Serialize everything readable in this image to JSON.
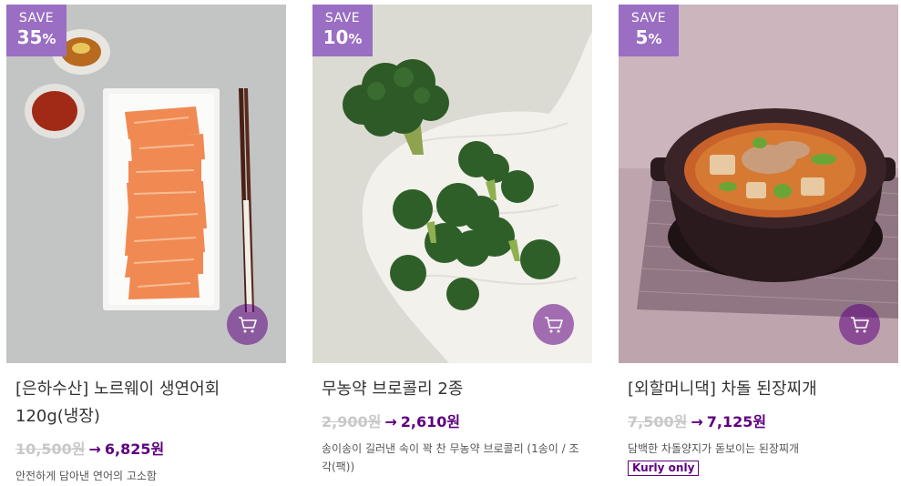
{
  "products": [
    {
      "save_label": "SAVE",
      "save_pct": "35",
      "pct_sign": "%",
      "title": "[은하수산] 노르웨이 생연어회 120g(냉장)",
      "original_price": "10,500원",
      "arrow": "→",
      "sale_price": "6,825원",
      "description": "안전하게 담아낸 연어의 고소함",
      "badge": ""
    },
    {
      "save_label": "SAVE",
      "save_pct": "10",
      "pct_sign": "%",
      "title": "무농약 브로콜리 2종",
      "original_price": "2,900원",
      "arrow": "→",
      "sale_price": "2,610원",
      "description": "송이송이 길러낸 속이 꽉 찬 무농약 브로콜리 (1송이 / 조각(팩))",
      "badge": ""
    },
    {
      "save_label": "SAVE",
      "save_pct": "5",
      "pct_sign": "%",
      "title": "[외할머니댁] 차돌 된장찌개",
      "original_price": "7,500원",
      "arrow": "→",
      "sale_price": "7,125원",
      "description": "담백한 차돌양지가 돋보이는 된장찌개",
      "badge": "Kurly only"
    }
  ],
  "icons": {
    "cart": "cart-icon"
  },
  "colors": {
    "accent": "#5f0080",
    "save_badge": "#9a6ec3",
    "strike": "#c8c8c8"
  }
}
